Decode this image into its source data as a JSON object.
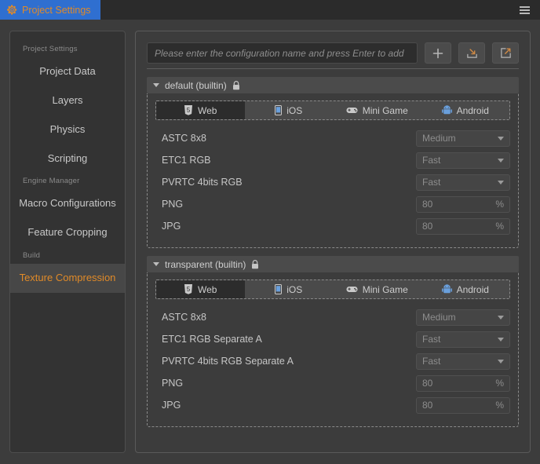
{
  "window": {
    "tab_label": "Project Settings",
    "tab_icon": "gear-icon",
    "menu_icon": "hamburger-menu-icon",
    "accent_blue": "#2f6fd0",
    "accent_orange": "#e08a28"
  },
  "sidebar": {
    "groups": [
      {
        "label": "Project Settings",
        "items": [
          {
            "label": "Project Data",
            "selected": false
          },
          {
            "label": "Layers",
            "selected": false
          },
          {
            "label": "Physics",
            "selected": false
          },
          {
            "label": "Scripting",
            "selected": false
          }
        ]
      },
      {
        "label": "Engine Manager",
        "items": [
          {
            "label": "Macro Configurations",
            "selected": false
          },
          {
            "label": "Feature Cropping",
            "selected": false
          }
        ]
      },
      {
        "label": "Build",
        "items": [
          {
            "label": "Texture Compression",
            "selected": true
          }
        ]
      }
    ]
  },
  "toolbar": {
    "input_value": "",
    "input_placeholder": "Please enter the configuration name and press Enter to add",
    "add_button_icon": "plus-icon",
    "import_button_icon": "import-icon",
    "export_button_icon": "export-icon"
  },
  "platform_tabs": [
    {
      "label": "Web",
      "icon": "html5-icon",
      "active": true
    },
    {
      "label": "iOS",
      "icon": "phone-icon",
      "active": false
    },
    {
      "label": "Mini Game",
      "icon": "gamepad-icon",
      "active": false
    },
    {
      "label": "Android",
      "icon": "android-icon",
      "active": false
    }
  ],
  "sections": [
    {
      "title": "default (builtin)",
      "locked": true,
      "lock_icon": "lock-icon",
      "caret_icon": "caret-down-icon",
      "rows": [
        {
          "label": "ASTC 8x8",
          "type": "select",
          "value": "Medium"
        },
        {
          "label": "ETC1 RGB",
          "type": "select",
          "value": "Fast"
        },
        {
          "label": "PVRTC 4bits RGB",
          "type": "select",
          "value": "Fast"
        },
        {
          "label": "PNG",
          "type": "number",
          "value": "80",
          "unit": "%"
        },
        {
          "label": "JPG",
          "type": "number",
          "value": "80",
          "unit": "%"
        }
      ]
    },
    {
      "title": "transparent (builtin)",
      "locked": true,
      "lock_icon": "lock-icon",
      "caret_icon": "caret-down-icon",
      "rows": [
        {
          "label": "ASTC 8x8",
          "type": "select",
          "value": "Medium"
        },
        {
          "label": "ETC1 RGB Separate A",
          "type": "select",
          "value": "Fast"
        },
        {
          "label": "PVRTC 4bits RGB Separate A",
          "type": "select",
          "value": "Fast"
        },
        {
          "label": "PNG",
          "type": "number",
          "value": "80",
          "unit": "%"
        },
        {
          "label": "JPG",
          "type": "number",
          "value": "80",
          "unit": "%"
        }
      ]
    }
  ]
}
